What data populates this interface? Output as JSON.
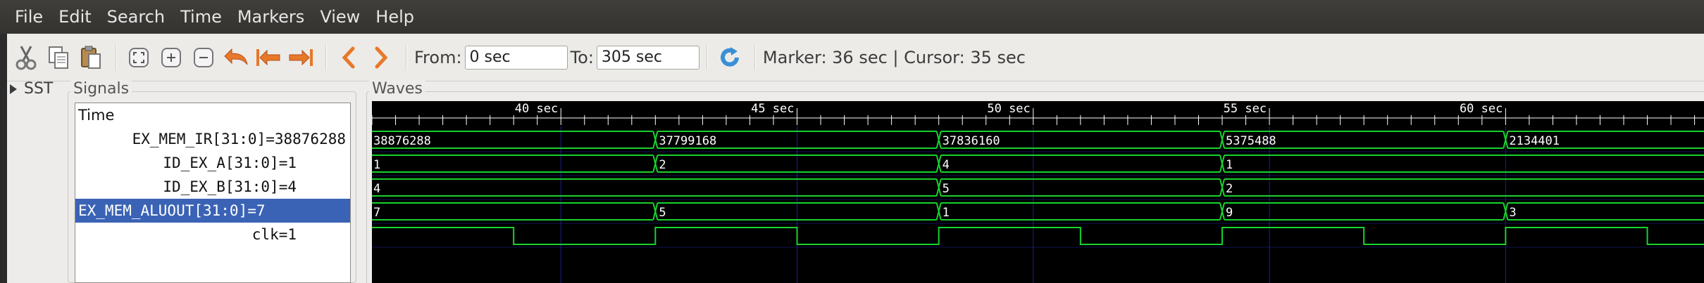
{
  "menu": [
    "File",
    "Edit",
    "Search",
    "Time",
    "Markers",
    "View",
    "Help"
  ],
  "toolbar": {
    "icons": [
      "cut-icon",
      "copy-icon",
      "paste-icon",
      "zoom-fit-icon",
      "zoom-in-icon",
      "zoom-out-icon",
      "undo-zoom-icon",
      "zoom-to-start-icon",
      "zoom-to-end-icon",
      "previous-edge-icon",
      "next-edge-icon",
      "reload-icon"
    ],
    "from_label": "From:",
    "from_value": "0 sec",
    "to_label": "To:",
    "to_value": "305 sec",
    "status": "Marker: 36 sec  |  Cursor: 35 sec"
  },
  "sst_label": "SST",
  "signals": {
    "title": "Signals",
    "time_label": "Time",
    "rows": [
      {
        "label": "EX_MEM_IR[31:0]=38876288",
        "selected": false
      },
      {
        "label": "ID_EX_A[31:0]=1",
        "selected": false
      },
      {
        "label": "ID_EX_B[31:0]=4",
        "selected": false
      },
      {
        "label": "EX_MEM_ALUOUT[31:0]=7",
        "selected": true
      },
      {
        "label": "clk=1",
        "selected": false
      }
    ]
  },
  "waves": {
    "title": "Waves",
    "time_labels": [
      "40 sec",
      "45 sec",
      "50 sec",
      "55 sec",
      "60 sec"
    ],
    "view_start": 36,
    "view_end": 64.2,
    "major_ticks": [
      40,
      45,
      50,
      55,
      60
    ],
    "colors": {
      "wave": "#18d22e",
      "grid": "#1e1e8c",
      "ruler": "#ffffff",
      "text": "#ffffff"
    },
    "buses": [
      {
        "name": "EX_MEM_IR",
        "segments": [
          {
            "t": 36,
            "v": "38876288"
          },
          {
            "t": 42,
            "v": "37799168"
          },
          {
            "t": 48,
            "v": "37836160"
          },
          {
            "t": 54,
            "v": "5375488"
          },
          {
            "t": 60,
            "v": "2134401"
          }
        ]
      },
      {
        "name": "ID_EX_A",
        "segments": [
          {
            "t": 36,
            "v": "1"
          },
          {
            "t": 42,
            "v": "2"
          },
          {
            "t": 48,
            "v": "4"
          },
          {
            "t": 54,
            "v": "1"
          }
        ]
      },
      {
        "name": "ID_EX_B",
        "segments": [
          {
            "t": 36,
            "v": "4"
          },
          {
            "t": 48,
            "v": "5"
          },
          {
            "t": 54,
            "v": "2"
          }
        ]
      },
      {
        "name": "EX_MEM_ALUOUT",
        "segments": [
          {
            "t": 36,
            "v": "7"
          },
          {
            "t": 42,
            "v": "5"
          },
          {
            "t": 48,
            "v": "1"
          },
          {
            "t": 54,
            "v": "9"
          },
          {
            "t": 60,
            "v": "3"
          }
        ]
      }
    ],
    "clock": {
      "period": 6,
      "high_start": 36,
      "duty": 0.5
    }
  }
}
